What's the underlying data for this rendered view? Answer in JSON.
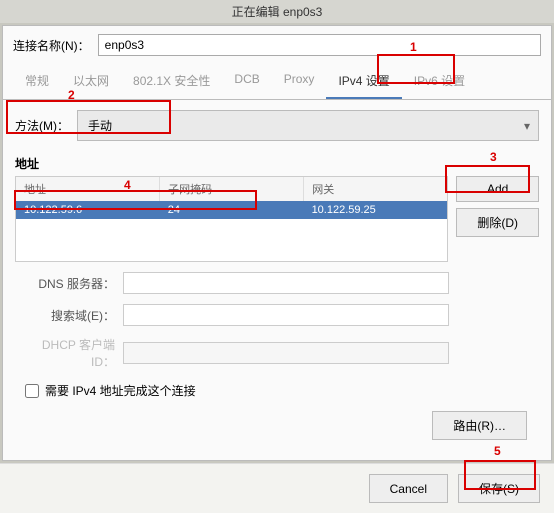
{
  "title": "正在编辑 enp0s3",
  "name_label": "连接名称(N)：",
  "name_value": "enp0s3",
  "tabs": {
    "t0": "常规",
    "t1": "以太网",
    "t2": "802.1X 安全性",
    "t3": "DCB",
    "t4": "Proxy",
    "t5": "IPv4 设置",
    "t6": "IPv6 设置"
  },
  "method_label": "方法(M)：",
  "method_value": "手动",
  "addr_label": "地址",
  "cols": {
    "c0": "地址",
    "c1": "子网掩码",
    "c2": "网关"
  },
  "row": {
    "addr": "10.122.59.6",
    "mask": "24",
    "gw": "10.122.59.25"
  },
  "btn_add": "Add",
  "btn_del": "删除(D)",
  "dns_label": "DNS 服务器：",
  "search_label": "搜索域(E)：",
  "dhcp_label": "DHCP 客户端 ID：",
  "require_label": "需要 IPv4 地址完成这个连接",
  "route_btn": "路由(R)…",
  "cancel": "Cancel",
  "save": "保存(S)",
  "ann": {
    "n1": "1",
    "n2": "2",
    "n3": "3",
    "n4": "4",
    "n5": "5"
  }
}
